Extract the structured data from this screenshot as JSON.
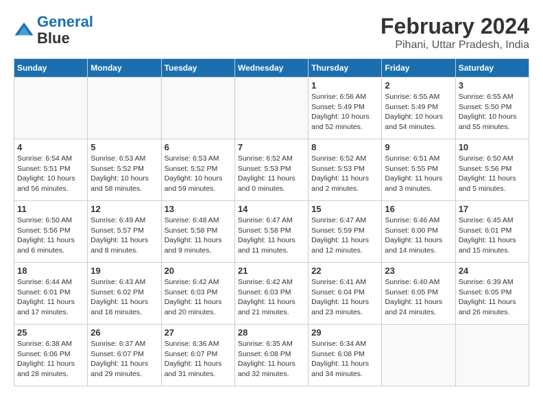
{
  "logo": {
    "line1": "General",
    "line2": "Blue"
  },
  "title": {
    "month_year": "February 2024",
    "location": "Pihani, Uttar Pradesh, India"
  },
  "weekdays": [
    "Sunday",
    "Monday",
    "Tuesday",
    "Wednesday",
    "Thursday",
    "Friday",
    "Saturday"
  ],
  "weeks": [
    [
      {
        "day": "",
        "sunrise": "",
        "sunset": "",
        "daylight": ""
      },
      {
        "day": "",
        "sunrise": "",
        "sunset": "",
        "daylight": ""
      },
      {
        "day": "",
        "sunrise": "",
        "sunset": "",
        "daylight": ""
      },
      {
        "day": "",
        "sunrise": "",
        "sunset": "",
        "daylight": ""
      },
      {
        "day": "1",
        "sunrise": "Sunrise: 6:56 AM",
        "sunset": "Sunset: 5:49 PM",
        "daylight": "Daylight: 10 hours and 52 minutes."
      },
      {
        "day": "2",
        "sunrise": "Sunrise: 6:55 AM",
        "sunset": "Sunset: 5:49 PM",
        "daylight": "Daylight: 10 hours and 54 minutes."
      },
      {
        "day": "3",
        "sunrise": "Sunrise: 6:55 AM",
        "sunset": "Sunset: 5:50 PM",
        "daylight": "Daylight: 10 hours and 55 minutes."
      }
    ],
    [
      {
        "day": "4",
        "sunrise": "Sunrise: 6:54 AM",
        "sunset": "Sunset: 5:51 PM",
        "daylight": "Daylight: 10 hours and 56 minutes."
      },
      {
        "day": "5",
        "sunrise": "Sunrise: 6:53 AM",
        "sunset": "Sunset: 5:52 PM",
        "daylight": "Daylight: 10 hours and 58 minutes."
      },
      {
        "day": "6",
        "sunrise": "Sunrise: 6:53 AM",
        "sunset": "Sunset: 5:52 PM",
        "daylight": "Daylight: 10 hours and 59 minutes."
      },
      {
        "day": "7",
        "sunrise": "Sunrise: 6:52 AM",
        "sunset": "Sunset: 5:53 PM",
        "daylight": "Daylight: 11 hours and 0 minutes."
      },
      {
        "day": "8",
        "sunrise": "Sunrise: 6:52 AM",
        "sunset": "Sunset: 5:53 PM",
        "daylight": "Daylight: 11 hours and 2 minutes."
      },
      {
        "day": "9",
        "sunrise": "Sunrise: 6:51 AM",
        "sunset": "Sunset: 5:55 PM",
        "daylight": "Daylight: 11 hours and 3 minutes."
      },
      {
        "day": "10",
        "sunrise": "Sunrise: 6:50 AM",
        "sunset": "Sunset: 5:56 PM",
        "daylight": "Daylight: 11 hours and 5 minutes."
      }
    ],
    [
      {
        "day": "11",
        "sunrise": "Sunrise: 6:50 AM",
        "sunset": "Sunset: 5:56 PM",
        "daylight": "Daylight: 11 hours and 6 minutes."
      },
      {
        "day": "12",
        "sunrise": "Sunrise: 6:49 AM",
        "sunset": "Sunset: 5:57 PM",
        "daylight": "Daylight: 11 hours and 8 minutes."
      },
      {
        "day": "13",
        "sunrise": "Sunrise: 6:48 AM",
        "sunset": "Sunset: 5:58 PM",
        "daylight": "Daylight: 11 hours and 9 minutes."
      },
      {
        "day": "14",
        "sunrise": "Sunrise: 6:47 AM",
        "sunset": "Sunset: 5:58 PM",
        "daylight": "Daylight: 11 hours and 11 minutes."
      },
      {
        "day": "15",
        "sunrise": "Sunrise: 6:47 AM",
        "sunset": "Sunset: 5:59 PM",
        "daylight": "Daylight: 11 hours and 12 minutes."
      },
      {
        "day": "16",
        "sunrise": "Sunrise: 6:46 AM",
        "sunset": "Sunset: 6:00 PM",
        "daylight": "Daylight: 11 hours and 14 minutes."
      },
      {
        "day": "17",
        "sunrise": "Sunrise: 6:45 AM",
        "sunset": "Sunset: 6:01 PM",
        "daylight": "Daylight: 11 hours and 15 minutes."
      }
    ],
    [
      {
        "day": "18",
        "sunrise": "Sunrise: 6:44 AM",
        "sunset": "Sunset: 6:01 PM",
        "daylight": "Daylight: 11 hours and 17 minutes."
      },
      {
        "day": "19",
        "sunrise": "Sunrise: 6:43 AM",
        "sunset": "Sunset: 6:02 PM",
        "daylight": "Daylight: 11 hours and 18 minutes."
      },
      {
        "day": "20",
        "sunrise": "Sunrise: 6:42 AM",
        "sunset": "Sunset: 6:03 PM",
        "daylight": "Daylight: 11 hours and 20 minutes."
      },
      {
        "day": "21",
        "sunrise": "Sunrise: 6:42 AM",
        "sunset": "Sunset: 6:03 PM",
        "daylight": "Daylight: 11 hours and 21 minutes."
      },
      {
        "day": "22",
        "sunrise": "Sunrise: 6:41 AM",
        "sunset": "Sunset: 6:04 PM",
        "daylight": "Daylight: 11 hours and 23 minutes."
      },
      {
        "day": "23",
        "sunrise": "Sunrise: 6:40 AM",
        "sunset": "Sunset: 6:05 PM",
        "daylight": "Daylight: 11 hours and 24 minutes."
      },
      {
        "day": "24",
        "sunrise": "Sunrise: 6:39 AM",
        "sunset": "Sunset: 6:05 PM",
        "daylight": "Daylight: 11 hours and 26 minutes."
      }
    ],
    [
      {
        "day": "25",
        "sunrise": "Sunrise: 6:38 AM",
        "sunset": "Sunset: 6:06 PM",
        "daylight": "Daylight: 11 hours and 28 minutes."
      },
      {
        "day": "26",
        "sunrise": "Sunrise: 6:37 AM",
        "sunset": "Sunset: 6:07 PM",
        "daylight": "Daylight: 11 hours and 29 minutes."
      },
      {
        "day": "27",
        "sunrise": "Sunrise: 6:36 AM",
        "sunset": "Sunset: 6:07 PM",
        "daylight": "Daylight: 11 hours and 31 minutes."
      },
      {
        "day": "28",
        "sunrise": "Sunrise: 6:35 AM",
        "sunset": "Sunset: 6:08 PM",
        "daylight": "Daylight: 11 hours and 32 minutes."
      },
      {
        "day": "29",
        "sunrise": "Sunrise: 6:34 AM",
        "sunset": "Sunset: 6:08 PM",
        "daylight": "Daylight: 11 hours and 34 minutes."
      },
      {
        "day": "",
        "sunrise": "",
        "sunset": "",
        "daylight": ""
      },
      {
        "day": "",
        "sunrise": "",
        "sunset": "",
        "daylight": ""
      }
    ]
  ]
}
